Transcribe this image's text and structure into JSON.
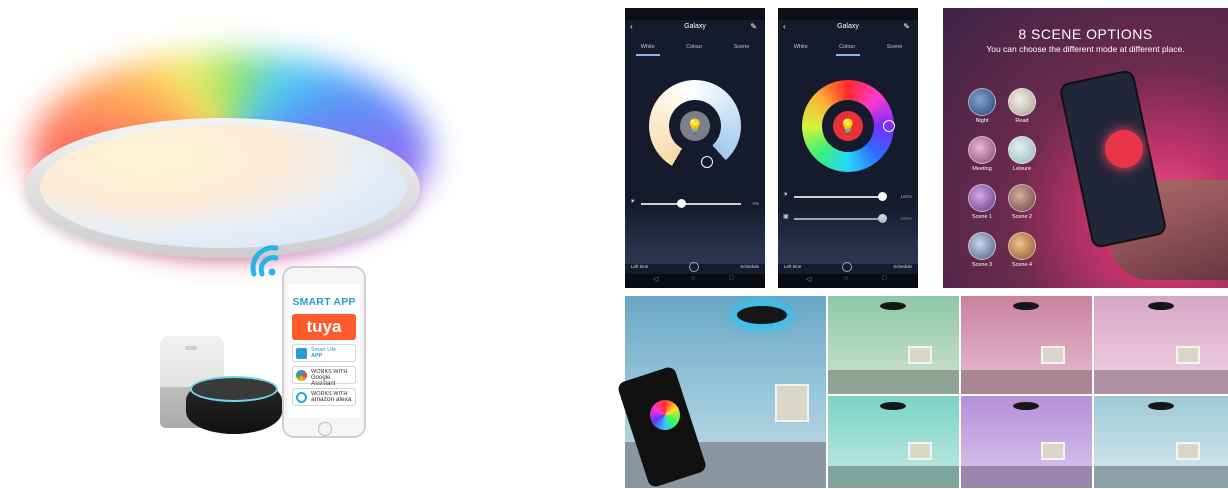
{
  "product": {
    "app_header": "SMART APP",
    "brand_logo": "tuya",
    "badges": [
      {
        "name": "smart-life-app-badge",
        "line1": "Smart Life",
        "line2": "APP",
        "color": "#2a9ad8"
      },
      {
        "name": "google-assistant-badge",
        "line1": "WORKS WITH",
        "line2": "Google Assistant",
        "color": "#4285f4"
      },
      {
        "name": "amazon-alexa-badge",
        "line1": "WORKS WITH",
        "line2": "amazon alexa",
        "color": "#1fa7e0"
      }
    ]
  },
  "app_screens": [
    {
      "title": "Galaxy",
      "tabs": [
        "White",
        "Colour",
        "Scene"
      ],
      "active_tab": 0,
      "slider1_pct": "0%",
      "bottom_left": "Left time",
      "bottom_right": "Schedule"
    },
    {
      "title": "Galaxy",
      "tabs": [
        "White",
        "Colour",
        "Scene"
      ],
      "active_tab": 1,
      "slider1_pct": "100%",
      "slider2_pct": "100%",
      "bottom_left": "Left time",
      "bottom_right": "Schedule"
    }
  ],
  "scene_panel": {
    "title": "8 SCENE OPTIONS",
    "subtitle": "You can choose  the different mode at different place.",
    "scenes": [
      "Night",
      "Read",
      "Meeting",
      "Leisure",
      "Scene 1",
      "Scene 2",
      "Scene 3",
      "Scene 4"
    ]
  },
  "room_tints": {
    "main": "#7fb8cf",
    "tiles": [
      "#8fc7a6",
      "#d28fb4",
      "#d7a6c6",
      "#79d3c4",
      "#b68fd9",
      "#9fc9d6"
    ]
  },
  "colors": {
    "tuya_orange": "#ff5a2b",
    "accent_blue": "#2a9ad8"
  }
}
